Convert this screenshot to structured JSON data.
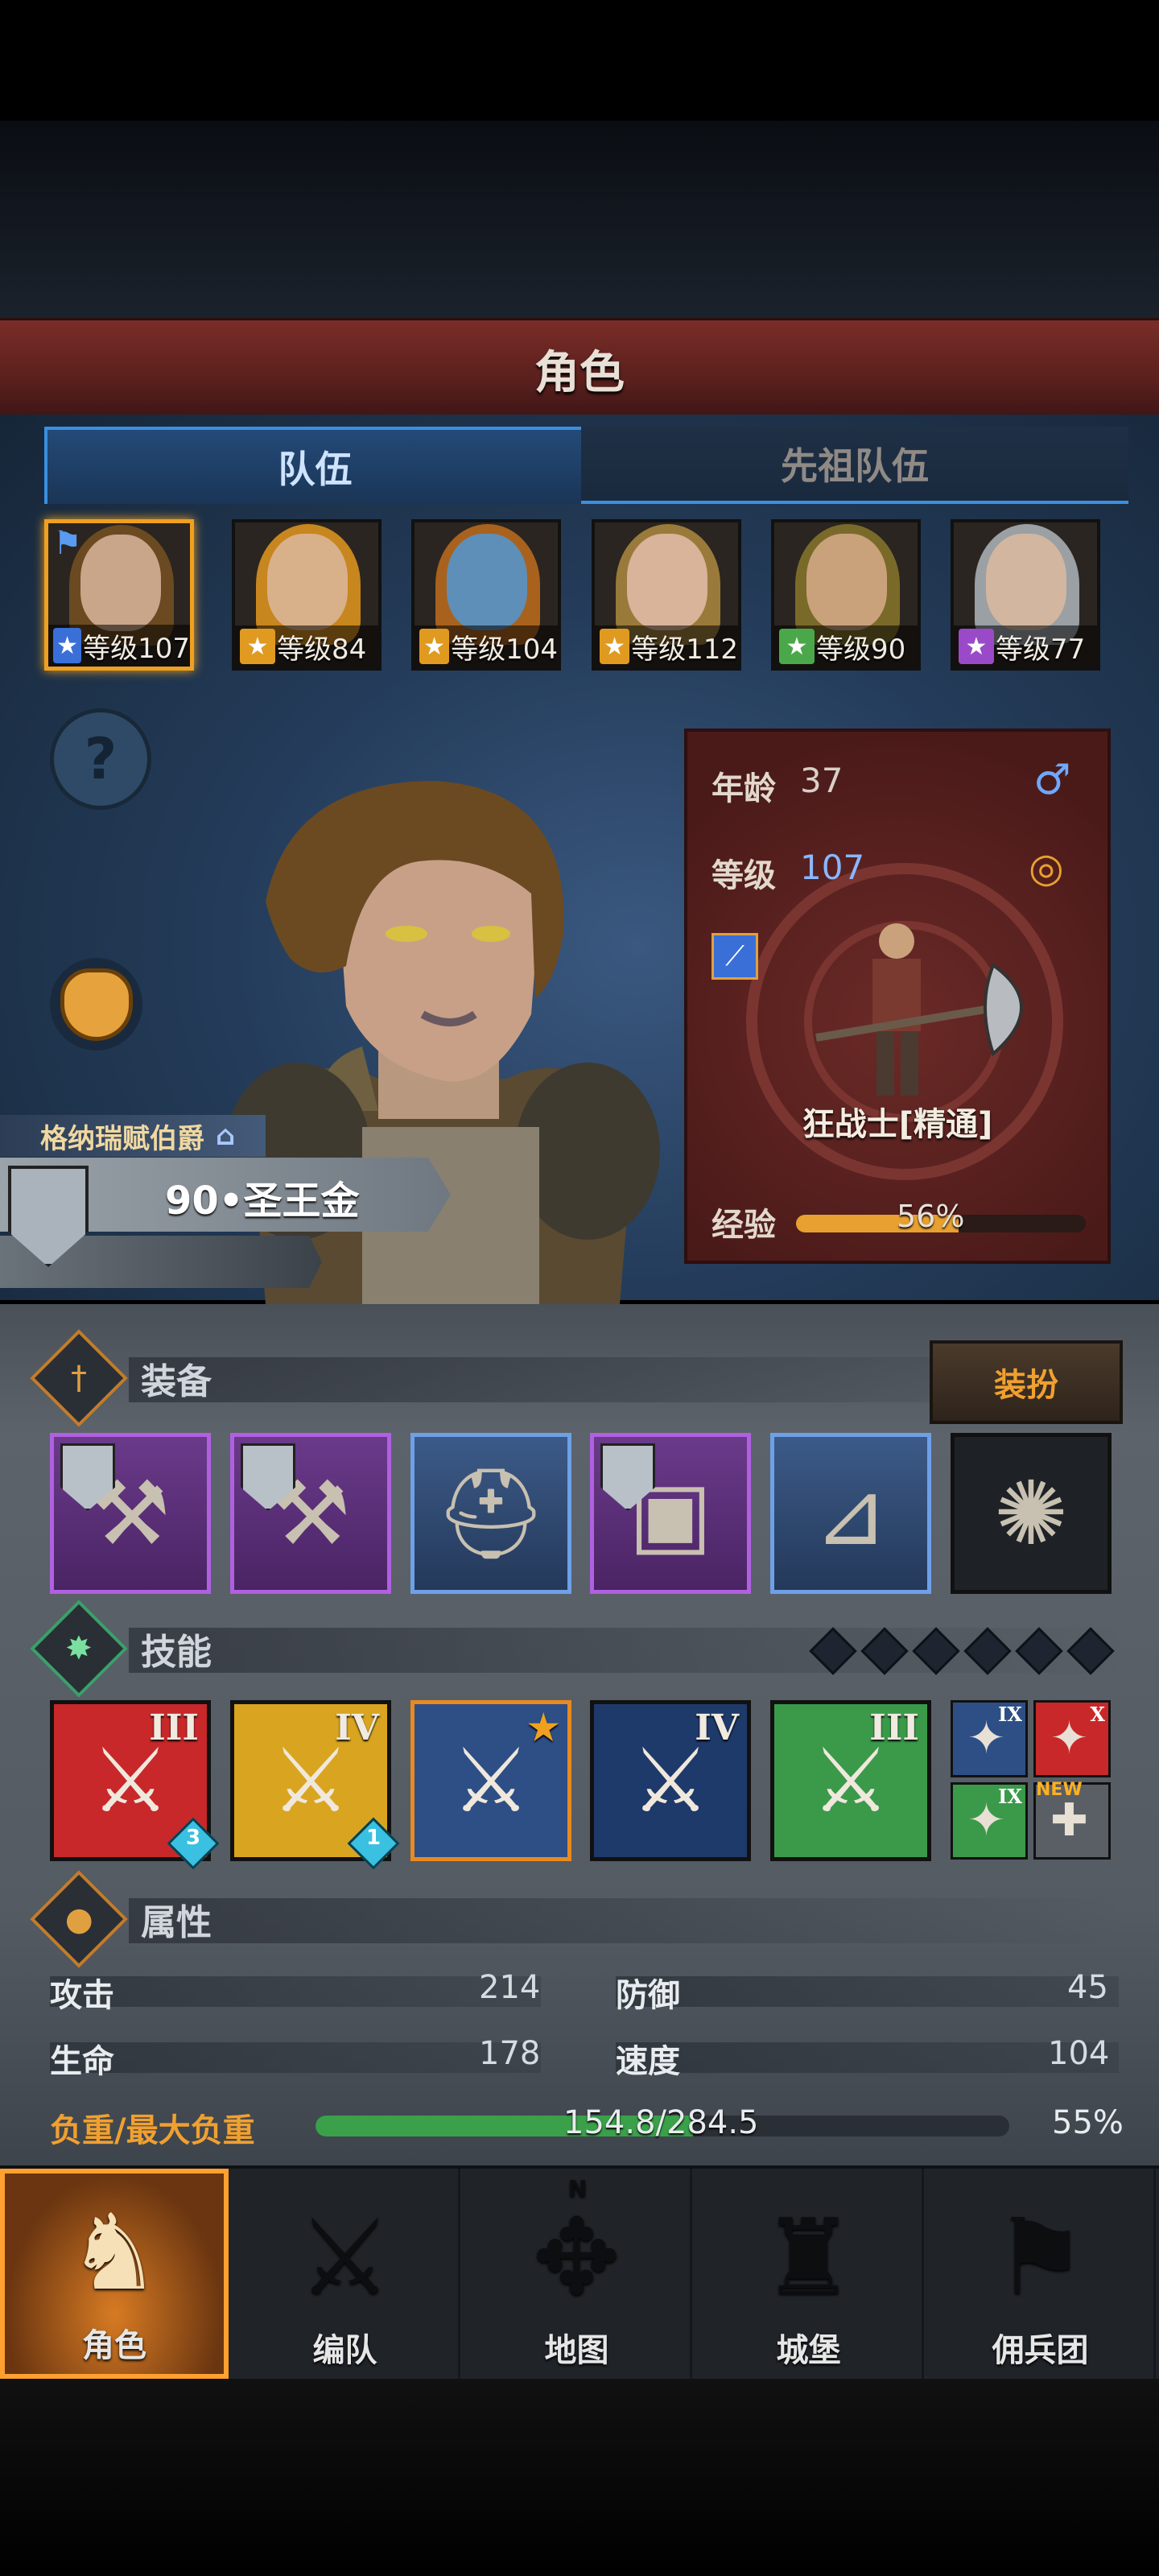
{
  "header": {
    "title": "角色"
  },
  "tabs": [
    {
      "label": "队伍",
      "active": true
    },
    {
      "label": "先祖队伍",
      "active": false
    }
  ],
  "team": [
    {
      "level_label": "等级107",
      "class_icon": "sword-class-icon",
      "class_color": "#3a6fd8",
      "hair": "#6b4a22",
      "skin": "#c9a58a",
      "selected": true
    },
    {
      "level_label": "等级84",
      "class_icon": "shield-class-icon",
      "class_color": "#e09a20",
      "hair": "#c7861e",
      "skin": "#d8b08a",
      "selected": false
    },
    {
      "level_label": "等级104",
      "class_icon": "shield-class-icon",
      "class_color": "#e09a20",
      "hair": "#a8621e",
      "skin": "#5d8fb8",
      "selected": false
    },
    {
      "level_label": "等级112",
      "class_icon": "shield-class-icon",
      "class_color": "#e09a20",
      "hair": "#9a7a3a",
      "skin": "#d9b39a",
      "selected": false
    },
    {
      "level_label": "等级90",
      "class_icon": "bow-class-icon",
      "class_color": "#4aa84a",
      "hair": "#7a6a2a",
      "skin": "#c9a27c",
      "selected": false
    },
    {
      "level_label": "等级77",
      "class_icon": "staff-class-icon",
      "class_color": "#9a4ac8",
      "hair": "#9aa0a4",
      "skin": "#d2b6a0",
      "selected": false
    }
  ],
  "character": {
    "house": "格纳瑞赋伯爵",
    "name": "90•圣王金",
    "age_label": "年龄",
    "age": "37",
    "gender_icon": "male-icon",
    "level_label": "等级",
    "level": "107",
    "ring_icon": "ring-icon",
    "class_name": "狂战士[精通]",
    "exp_label": "经验",
    "exp_percent": "56%",
    "exp_fraction": 0.56
  },
  "equipment": {
    "title": "装备",
    "dress_button": "装扮",
    "slots": [
      {
        "name": "axe-icon",
        "rarity": "purple",
        "shield": true
      },
      {
        "name": "axe-icon",
        "rarity": "purple",
        "shield": true
      },
      {
        "name": "helmet-icon",
        "rarity": "blue",
        "shield": false
      },
      {
        "name": "armor-icon",
        "rarity": "purple",
        "shield": true
      },
      {
        "name": "boots-icon",
        "rarity": "blue",
        "shield": false
      },
      {
        "name": "amulet-icon",
        "rarity": "dark",
        "shield": false
      }
    ]
  },
  "skills": {
    "title": "技能",
    "main": [
      {
        "rank": "III",
        "gem": "3",
        "color": "#c8282a"
      },
      {
        "rank": "IV",
        "gem": "1",
        "color": "#d9a520"
      },
      {
        "rank": "",
        "gem": "",
        "color": "#2d4f86",
        "star": true
      },
      {
        "rank": "IV",
        "gem": "",
        "color": "#1e3a6a"
      },
      {
        "rank": "III",
        "gem": "",
        "color": "#3a9a4a"
      }
    ],
    "small": [
      {
        "rank": "IX",
        "color": "#2d4f86",
        "new": false
      },
      {
        "rank": "X",
        "color": "#c8282a",
        "new": false
      },
      {
        "rank": "IX",
        "color": "#3a9a4a",
        "new": false
      },
      {
        "rank": "",
        "color": "#5a5f66",
        "new": true,
        "new_label": "NEW"
      }
    ]
  },
  "attributes": {
    "title": "属性",
    "stats": [
      {
        "label": "攻击",
        "value": "214"
      },
      {
        "label": "防御",
        "value": "45"
      },
      {
        "label": "生命",
        "value": "178"
      },
      {
        "label": "速度",
        "value": "104"
      }
    ],
    "load_label": "负重/最大负重",
    "load_value": "154.8/284.5",
    "load_percent": "55%",
    "load_fraction": 0.544
  },
  "nav": [
    {
      "label": "角色",
      "icon": "knight-icon",
      "active": true
    },
    {
      "label": "编队",
      "icon": "formation-icon",
      "active": false
    },
    {
      "label": "地图",
      "icon": "compass-map-icon",
      "active": false,
      "compass_n": "N"
    },
    {
      "label": "城堡",
      "icon": "castle-icon",
      "active": false
    },
    {
      "label": "佣兵团",
      "icon": "mercenary-icon",
      "active": false
    }
  ],
  "colors": {
    "accent": "#f0a020",
    "exp_bar": "#e8a030",
    "load_bar": "#3aa04a",
    "stat_value": "#8ab6ff"
  }
}
